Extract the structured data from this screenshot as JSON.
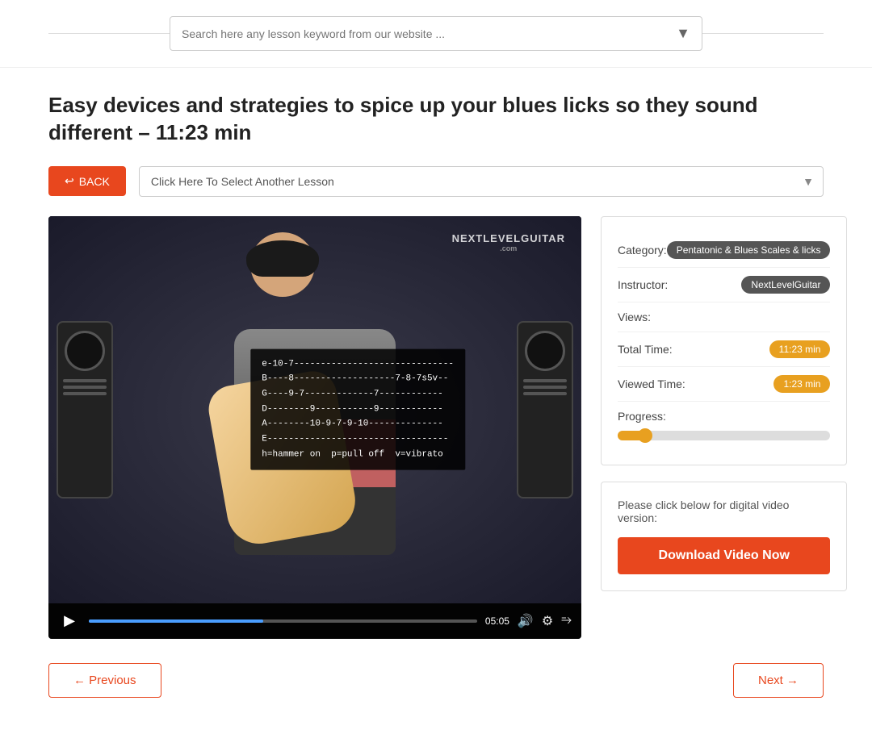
{
  "header": {
    "search_placeholder": "Search here any lesson keyword from our website ..."
  },
  "page": {
    "title": "Easy devices and strategies to spice up your blues licks so they sound different – 11:23 min",
    "back_label": "BACK",
    "lesson_select_placeholder": "Click Here To Select Another Lesson"
  },
  "video": {
    "current_time": "05:05",
    "progress_percent": 45
  },
  "sidebar": {
    "category_label": "Category:",
    "category_badge": "Pentatonic & Blues Scales & licks",
    "instructor_label": "Instructor:",
    "instructor_badge": "NextLevelGuitar",
    "views_label": "Views:",
    "views_value": "",
    "total_time_label": "Total Time:",
    "total_time_badge": "11:23 min",
    "viewed_time_label": "Viewed Time:",
    "viewed_time_badge": "1:23 min",
    "progress_label": "Progress:",
    "progress_percent": 13,
    "download_prompt": "Please click below for digital video version:",
    "download_button": "Download Video Now"
  },
  "tab_notation": "e-10-7------------------------------\nB----8-------------------7-8-7s5v--\nG----9-7-------------7------------\nD--------9-----------9------------\nA--------10-9-7-9-10--------------\nE----------------------------------\nh=hammer on  p=pull off  v=vibrato",
  "logo": {
    "line1": "NEXTLEVELGUITAR",
    "line2": ".com"
  },
  "navigation": {
    "previous_label": "← Previous",
    "next_label": "Next →"
  }
}
